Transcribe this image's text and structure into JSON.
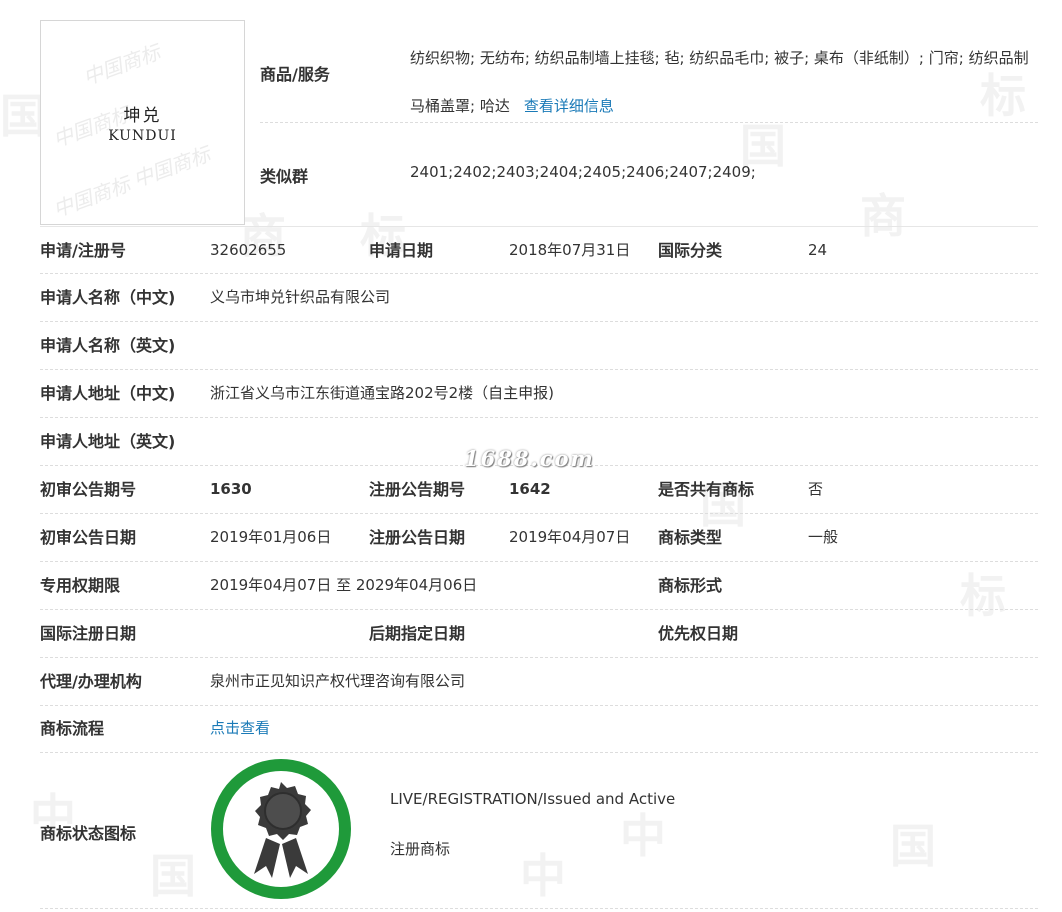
{
  "watermarks": {
    "background_glyph_1": "中",
    "background_glyph_2": "国",
    "background_glyph_3": "商",
    "background_glyph_4": "标",
    "logo_watermark": "中国商标",
    "site_watermark": "1688.com"
  },
  "trademark_image": {
    "name_cn": "坤兑",
    "name_en": "KUNDUI"
  },
  "goods": {
    "label": "商品/服务",
    "value": "纺织织物; 无纺布; 纺织品制墙上挂毯; 毡; 纺织品毛巾; 被子; 桌布（非纸制）; 门帘; 纺织品制马桶盖罩; 哈达",
    "detail_link": "查看详细信息"
  },
  "similar_group": {
    "label": "类似群",
    "value": "2401;2402;2403;2404;2405;2406;2407;2409;"
  },
  "rows": {
    "reg_no": {
      "label": "申请/注册号",
      "value": "32602655"
    },
    "apply_date": {
      "label": "申请日期",
      "value": "2018年07月31日"
    },
    "intl_class": {
      "label": "国际分类",
      "value": "24"
    },
    "applicant_cn": {
      "label": "申请人名称（中文)",
      "value": "义乌市坤兑针织品有限公司"
    },
    "applicant_en": {
      "label": "申请人名称（英文)",
      "value": ""
    },
    "address_cn": {
      "label": "申请人地址（中文)",
      "value": "浙江省义乌市江东街道通宝路202号2楼（自主申报)"
    },
    "address_en": {
      "label": "申请人地址（英文)",
      "value": ""
    },
    "prelim_no": {
      "label": "初审公告期号",
      "value": "1630"
    },
    "reg_pub_no": {
      "label": "注册公告期号",
      "value": "1642"
    },
    "shared": {
      "label": "是否共有商标",
      "value": "否"
    },
    "prelim_date": {
      "label": "初审公告日期",
      "value": "2019年01月06日"
    },
    "reg_pub_date": {
      "label": "注册公告日期",
      "value": "2019年04月07日"
    },
    "tm_type": {
      "label": "商标类型",
      "value": "一般"
    },
    "exclusive_period": {
      "label": "专用权期限",
      "value": "2019年04月07日 至 2029年04月06日"
    },
    "tm_form": {
      "label": "商标形式",
      "value": ""
    },
    "intl_reg_date": {
      "label": "国际注册日期",
      "value": ""
    },
    "later_designation": {
      "label": "后期指定日期",
      "value": ""
    },
    "priority_date": {
      "label": "优先权日期",
      "value": ""
    },
    "agent": {
      "label": "代理/办理机构",
      "value": "泉州市正见知识产权代理咨询有限公司"
    },
    "process": {
      "label": "商标流程",
      "link": "点击查看"
    }
  },
  "status": {
    "label": "商标状态图标",
    "status_en": "LIVE/REGISTRATION/Issued and Active",
    "status_cn": "注册商标",
    "badge_ring_color": "#1f9a3a",
    "badge_icon": "award-ribbon-icon"
  },
  "colors": {
    "link": "#1a7ab7",
    "text": "#333333",
    "divider": "#dddddd"
  }
}
